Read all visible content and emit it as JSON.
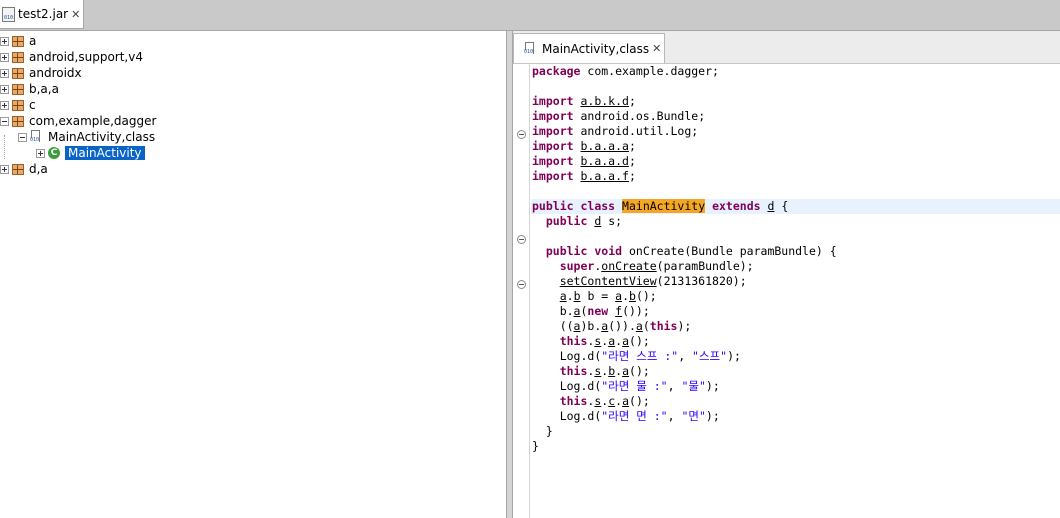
{
  "top_tab": {
    "label": "test2.jar",
    "icon": "jar-file-icon"
  },
  "tree": {
    "items": [
      {
        "label": "a"
      },
      {
        "label": "android,support,v4"
      },
      {
        "label": "androidx"
      },
      {
        "label": "b,a,a"
      },
      {
        "label": "c"
      },
      {
        "label": "com,example,dagger"
      },
      {
        "label": "MainActivity,class"
      },
      {
        "label": "MainActivity"
      },
      {
        "label": "d,a"
      }
    ]
  },
  "editor": {
    "tab_label": "MainActivity,class",
    "code": {
      "package_kw": "package",
      "package_name": " com.example.dagger;",
      "import_kw": "import",
      "imports": [
        "a.b.k.d",
        "android.os.Bundle",
        "android.util.Log",
        "b.a.a.a",
        "b.a.a.d",
        "b.a.a.f"
      ],
      "class_public": "public",
      "class_kw": "class",
      "class_name": "MainActivity",
      "extends_kw": "extends",
      "parent": "d",
      "field_public": "public",
      "field_type": "d",
      "field_name": " s;",
      "method_public": "public",
      "method_void": "void",
      "method_sig": " onCreate(Bundle paramBundle) {",
      "super_kw": "super",
      "oncreate": "onCreate",
      "super_args": "(paramBundle);",
      "setcontentview": "setContentView",
      "setcontentview_args": "(2131361820);",
      "new_kw": "new",
      "this_kw": "this",
      "log_prefix": "Log.d(",
      "log1_tag": "\"라면 스프 :\"",
      "log1_msg": "\"스프\"",
      "log2_tag": "\"라면 물 :\"",
      "log2_msg": "\"물\"",
      "log3_tag": "\"라면 면 :\"",
      "log3_msg": "\"면\""
    }
  }
}
